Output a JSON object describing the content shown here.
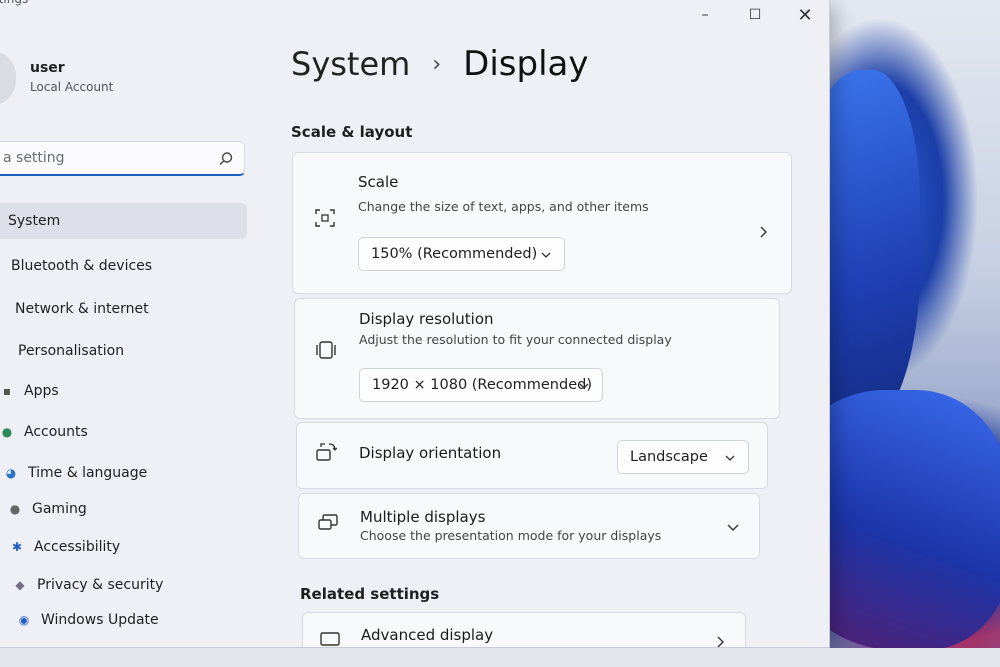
{
  "window": {
    "app_title": "ttings",
    "controls": {
      "minimize": "–",
      "maximize": "☐",
      "close": "✕"
    }
  },
  "user": {
    "name": "user",
    "account_type": "Local Account"
  },
  "search": {
    "placeholder": "a setting"
  },
  "nav": [
    {
      "label": "System",
      "icon": "monitor-icon",
      "active": true
    },
    {
      "label": "Bluetooth & devices",
      "icon": "bluetooth-icon"
    },
    {
      "label": "Network & internet",
      "icon": "wifi-icon"
    },
    {
      "label": "Personalisation",
      "icon": "brush-icon"
    },
    {
      "label": "Apps",
      "icon": "apps-icon"
    },
    {
      "label": "Accounts",
      "icon": "person-icon"
    },
    {
      "label": "Time & language",
      "icon": "globe-icon"
    },
    {
      "label": "Gaming",
      "icon": "gamepad-icon"
    },
    {
      "label": "Accessibility",
      "icon": "accessibility-icon"
    },
    {
      "label": "Privacy & security",
      "icon": "shield-icon"
    },
    {
      "label": "Windows Update",
      "icon": "update-icon"
    }
  ],
  "breadcrumb": {
    "parent": "System",
    "separator": "›",
    "current": "Display"
  },
  "sections": {
    "scale_layout": "Scale & layout",
    "related": "Related settings"
  },
  "cards": {
    "scale": {
      "title": "Scale",
      "description": "Change the size of text, apps, and other items",
      "value": "150% (Recommended)",
      "icon": "scale-icon"
    },
    "resolution": {
      "title": "Display resolution",
      "description": "Adjust the resolution to fit your connected display",
      "value": "1920 × 1080 (Recommended)",
      "icon": "resolution-icon"
    },
    "orientation": {
      "title": "Display orientation",
      "value": "Landscape",
      "icon": "orientation-icon"
    },
    "multiple": {
      "title": "Multiple displays",
      "description": "Choose the presentation mode for your displays",
      "icon": "multiple-displays-icon"
    },
    "advanced": {
      "title": "Advanced display",
      "icon": "monitor-icon"
    }
  },
  "colors": {
    "accent": "#1f5ec2",
    "window_bg": "#eef0f5",
    "card_bg": "#f8f9fb"
  }
}
